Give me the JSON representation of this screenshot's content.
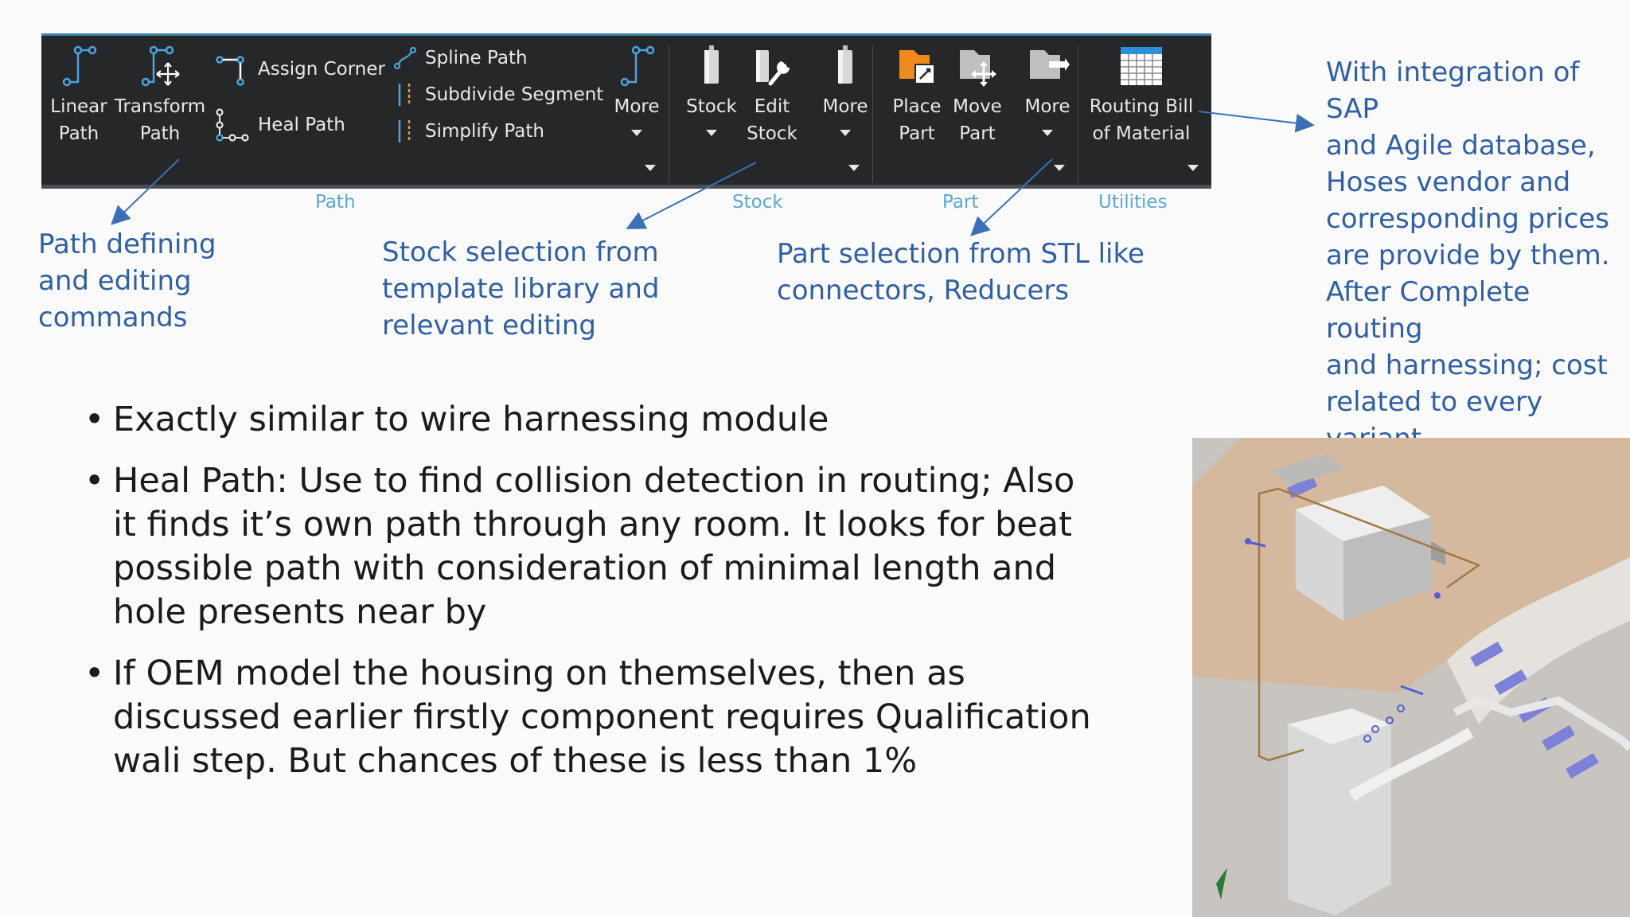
{
  "ribbon": {
    "path_group": {
      "linear_path": "Linear\nPath",
      "transform_path": "Transform\nPath",
      "assign_corner": "Assign Corner",
      "heal_path": "Heal Path",
      "spline_path": "Spline Path",
      "subdivide_segment": "Subdivide Segment",
      "simplify_path": "Simplify Path",
      "more": "More",
      "label": "Path"
    },
    "stock_group": {
      "stock": "Stock",
      "edit_stock": "Edit\nStock",
      "more": "More",
      "label": "Stock"
    },
    "part_group": {
      "place_part": "Place\nPart",
      "move_part": "Move\nPart",
      "more": "More",
      "label": "Part"
    },
    "utilities_group": {
      "routing_bom": "Routing Bill\nof Material",
      "label": "Utilities"
    }
  },
  "annotations": {
    "path_note": "Path defining\nand  editing\ncommands",
    "stock_note": "Stock selection from\ntemplate library and\nrelevant editing",
    "part_note": "Part selection from STL like\nconnectors, Reducers",
    "utilities_note": "With integration of SAP\nand Agile database,\nHoses vendor and\ncorresponding prices\nare provide by them.\nAfter Complete routing\nand harnessing; cost\nrelated to every variant\ncan easily be evaluated."
  },
  "bullets": [
    "Exactly similar to wire harnessing module",
    "Heal Path: Use to find collision detection in routing; Also it finds it’s own path through any room. It looks for beat possible path with consideration of minimal length and hole presents near by",
    "If OEM model the housing on themselves, then as discussed earlier firstly component requires Qualification wali step. But chances of these is less than 1%"
  ],
  "colors": {
    "ribbon_bg": "#262729",
    "group_label": "#5aa7d6",
    "annotation_text": "#2f5fa6",
    "arrow": "#3b6fb8"
  }
}
